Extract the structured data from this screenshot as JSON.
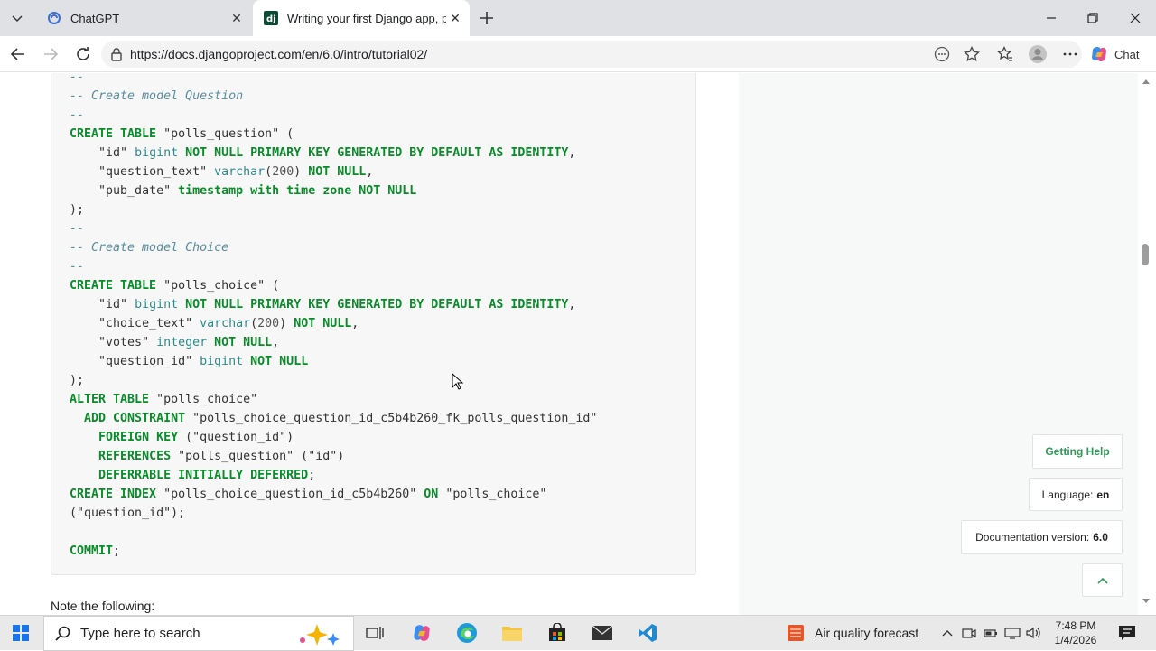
{
  "browser": {
    "tabs": [
      {
        "title": "ChatGPT",
        "icon": "chatgpt-icon",
        "active": false
      },
      {
        "title": "Writing your first Django app, part",
        "icon": "django-icon",
        "active": true
      }
    ],
    "url": "https://docs.djangoproject.com/en/6.0/intro/tutorial02/",
    "chat_label": "Chat"
  },
  "code": [
    [
      [
        "cm",
        "--"
      ]
    ],
    [
      [
        "cm",
        "-- Create model Question"
      ]
    ],
    [
      [
        "cm",
        "--"
      ]
    ],
    [
      [
        "kw",
        "CREATE TABLE "
      ],
      [
        "st",
        "\"polls_question\""
      ],
      [
        "pn",
        " ("
      ]
    ],
    [
      [
        "pn",
        "    "
      ],
      [
        "st",
        "\"id\" "
      ],
      [
        "tp",
        "bigint "
      ],
      [
        "kw",
        "NOT NULL PRIMARY KEY GENERATED BY DEFAULT AS IDENTITY"
      ],
      [
        "pn",
        ","
      ]
    ],
    [
      [
        "pn",
        "    "
      ],
      [
        "st",
        "\"question_text\" "
      ],
      [
        "tp",
        "varchar"
      ],
      [
        "pn",
        "("
      ],
      [
        "nm",
        "200"
      ],
      [
        "pn",
        ") "
      ],
      [
        "kw",
        "NOT NULL"
      ],
      [
        "pn",
        ","
      ]
    ],
    [
      [
        "pn",
        "    "
      ],
      [
        "st",
        "\"pub_date\" "
      ],
      [
        "kw",
        "timestamp with time zone NOT NULL"
      ]
    ],
    [
      [
        "pn",
        ");"
      ]
    ],
    [
      [
        "cm",
        "--"
      ]
    ],
    [
      [
        "cm",
        "-- Create model Choice"
      ]
    ],
    [
      [
        "cm",
        "--"
      ]
    ],
    [
      [
        "kw",
        "CREATE TABLE "
      ],
      [
        "st",
        "\"polls_choice\""
      ],
      [
        "pn",
        " ("
      ]
    ],
    [
      [
        "pn",
        "    "
      ],
      [
        "st",
        "\"id\" "
      ],
      [
        "tp",
        "bigint "
      ],
      [
        "kw",
        "NOT NULL PRIMARY KEY GENERATED BY DEFAULT AS IDENTITY"
      ],
      [
        "pn",
        ","
      ]
    ],
    [
      [
        "pn",
        "    "
      ],
      [
        "st",
        "\"choice_text\" "
      ],
      [
        "tp",
        "varchar"
      ],
      [
        "pn",
        "("
      ],
      [
        "nm",
        "200"
      ],
      [
        "pn",
        ") "
      ],
      [
        "kw",
        "NOT NULL"
      ],
      [
        "pn",
        ","
      ]
    ],
    [
      [
        "pn",
        "    "
      ],
      [
        "st",
        "\"votes\" "
      ],
      [
        "tp",
        "integer "
      ],
      [
        "kw",
        "NOT NULL"
      ],
      [
        "pn",
        ","
      ]
    ],
    [
      [
        "pn",
        "    "
      ],
      [
        "st",
        "\"question_id\" "
      ],
      [
        "tp",
        "bigint "
      ],
      [
        "kw",
        "NOT NULL"
      ]
    ],
    [
      [
        "pn",
        ");"
      ]
    ],
    [
      [
        "kw",
        "ALTER TABLE "
      ],
      [
        "st",
        "\"polls_choice\""
      ]
    ],
    [
      [
        "pn",
        "  "
      ],
      [
        "kw",
        "ADD CONSTRAINT "
      ],
      [
        "st",
        "\"polls_choice_question_id_c5b4b260_fk_polls_question_id\""
      ]
    ],
    [
      [
        "pn",
        "    "
      ],
      [
        "kw",
        "FOREIGN KEY "
      ],
      [
        "st",
        "(\"question_id\")"
      ]
    ],
    [
      [
        "pn",
        "    "
      ],
      [
        "kw",
        "REFERENCES "
      ],
      [
        "st",
        "\"polls_question\" (\"id\")"
      ]
    ],
    [
      [
        "pn",
        "    "
      ],
      [
        "kw",
        "DEFERRABLE INITIALLY DEFERRED"
      ],
      [
        "pn",
        ";"
      ]
    ],
    [
      [
        "kw",
        "CREATE INDEX "
      ],
      [
        "st",
        "\"polls_choice_question_id_c5b4b260\" "
      ],
      [
        "kw",
        "ON "
      ],
      [
        "st",
        "\"polls_choice\""
      ]
    ],
    [
      [
        "st",
        "(\"question_id\")"
      ],
      [
        "pn",
        ";"
      ]
    ],
    [
      [
        "pn",
        ""
      ]
    ],
    [
      [
        "kw",
        "COMMIT"
      ],
      [
        "pn",
        ";"
      ]
    ]
  ],
  "note_text": "Note the following:",
  "sidebar": {
    "getting_help": "Getting Help",
    "language_label": "Language:",
    "language_value": "en",
    "version_label": "Documentation version:",
    "version_value": "6.0"
  },
  "taskbar": {
    "search_placeholder": "Type here to search",
    "weather": "Air quality forecast",
    "time": "7:48 PM",
    "date": "1/4/2026"
  }
}
